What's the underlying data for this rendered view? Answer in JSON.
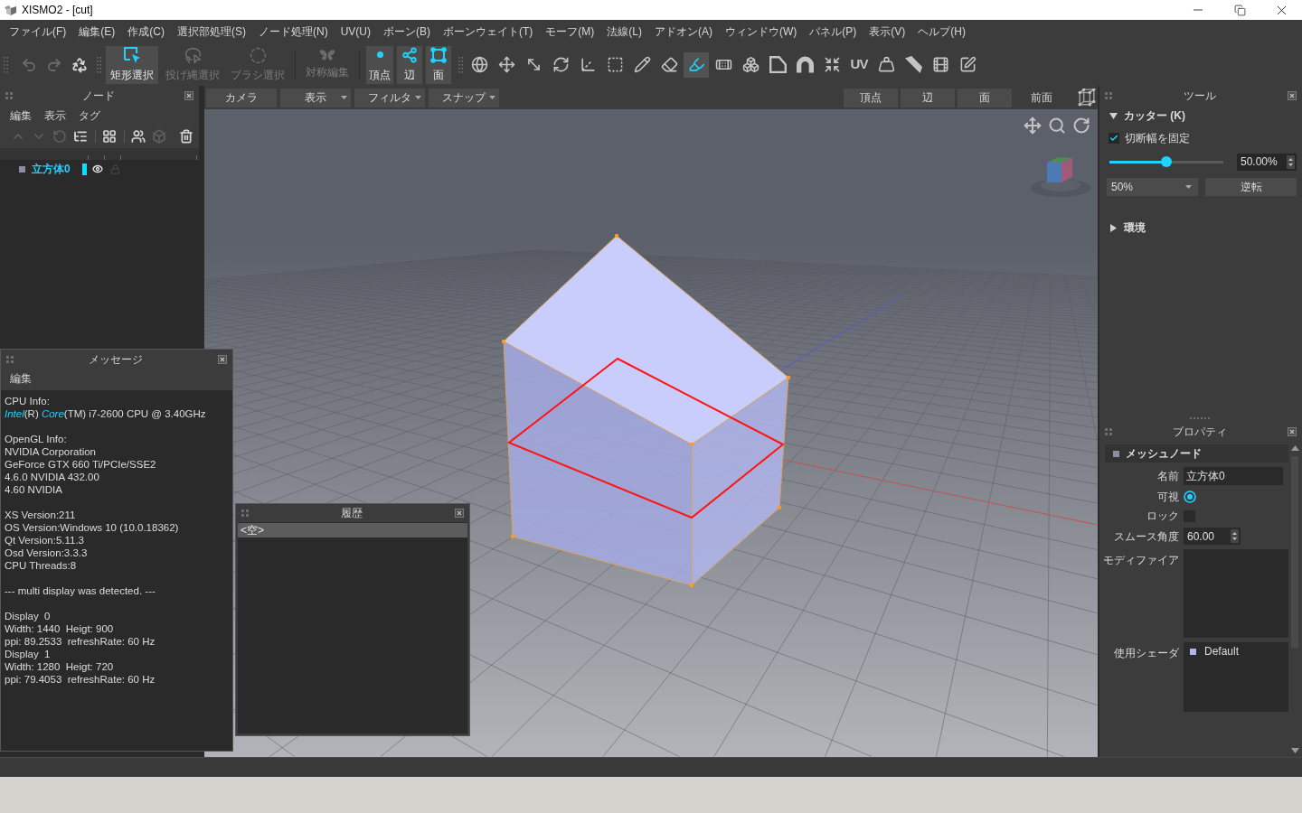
{
  "window": {
    "title": "XISMO2 - [cut]"
  },
  "menu": [
    "ファイル(F)",
    "編集(E)",
    "作成(C)",
    "選択部処理(S)",
    "ノード処理(N)",
    "UV(U)",
    "ボーン(B)",
    "ボーンウェイト(T)",
    "モーフ(M)",
    "法線(L)",
    "アドオン(A)",
    "ウィンドウ(W)",
    "パネル(P)",
    "表示(V)",
    "ヘルプ(H)"
  ],
  "toolbar": {
    "history_tools": [
      {
        "kind": "undo",
        "disabled": true
      },
      {
        "kind": "redo",
        "disabled": true
      },
      {
        "kind": "recycle",
        "disabled": false
      }
    ],
    "select_modes": [
      {
        "kind": "rect",
        "label": "矩形選択",
        "selected": true
      },
      {
        "kind": "lasso",
        "label": "投げ縄選択",
        "selected": false
      },
      {
        "kind": "brush",
        "label": "ブラシ選択",
        "selected": false
      }
    ],
    "symmetry": {
      "label": "対称編集",
      "on": false
    },
    "element_modes": [
      {
        "kind": "vertex",
        "label": "頂点",
        "selected": true
      },
      {
        "kind": "edge",
        "label": "辺",
        "selected": true
      },
      {
        "kind": "face",
        "label": "面",
        "selected": true
      }
    ],
    "tools": [
      {
        "kind": "globe",
        "selected": false
      },
      {
        "kind": "move",
        "selected": false
      },
      {
        "kind": "scale",
        "selected": false
      },
      {
        "kind": "rotate",
        "selected": false
      },
      {
        "kind": "pivot",
        "selected": false
      },
      {
        "kind": "marquee",
        "selected": false
      },
      {
        "kind": "pencil",
        "selected": false
      },
      {
        "kind": "eraser",
        "selected": false
      },
      {
        "kind": "cutter",
        "selected": true
      },
      {
        "kind": "bandage",
        "selected": false
      },
      {
        "kind": "boxes",
        "selected": false
      },
      {
        "kind": "plane",
        "selected": false
      },
      {
        "kind": "arch",
        "selected": false
      },
      {
        "kind": "shrink",
        "selected": false
      },
      {
        "kind": "text",
        "label": "UV",
        "selected": false
      },
      {
        "kind": "weight",
        "selected": false
      },
      {
        "kind": "blade",
        "selected": false
      },
      {
        "kind": "film",
        "selected": false
      },
      {
        "kind": "edit",
        "selected": false
      }
    ]
  },
  "node_panel": {
    "title": "ノード",
    "menu": [
      "編集",
      "表示",
      "タグ"
    ],
    "tools": [
      {
        "kind": "up",
        "disabled": true
      },
      {
        "kind": "down",
        "disabled": true
      },
      {
        "kind": "reset",
        "disabled": true
      },
      {
        "kind": "hierarchy",
        "disabled": false
      },
      {
        "kind": "grid",
        "disabled": false
      },
      {
        "kind": "group",
        "disabled": false
      },
      {
        "kind": "cube",
        "disabled": true
      },
      {
        "kind": "trash",
        "disabled": false
      }
    ],
    "tree": [
      {
        "name": "立方体0",
        "selected": true,
        "color": "#00e5ff",
        "visible": true,
        "locked": false
      }
    ]
  },
  "viewport": {
    "menus": [
      {
        "label": "カメラ",
        "dropdown": false
      },
      {
        "label": "表示",
        "dropdown": true
      },
      {
        "label": "フィルタ",
        "dropdown": true
      },
      {
        "label": "スナップ",
        "dropdown": true
      }
    ],
    "element_buttons": [
      "頂点",
      "辺",
      "面"
    ],
    "view_name": "前面"
  },
  "message_panel": {
    "title": "メッセージ",
    "menu": [
      "編集"
    ],
    "blocks": [
      [
        "CPU Info:",
        "*Intel*(R) *Core*(TM) i7-2600 CPU @ 3.40GHz"
      ],
      [
        "OpenGL Info:",
        "NVIDIA Corporation",
        "GeForce GTX 660 Ti/PCIe/SSE2",
        "4.6.0 NVIDIA 432.00",
        "4.60 NVIDIA"
      ],
      [
        "XS Version:211",
        "OS Version:Windows 10 (10.0.18362)",
        "Qt Version:5.11.3",
        "Osd Version:3.3.3",
        "CPU Threads:8"
      ],
      [
        "--- multi display was detected. ---"
      ],
      [
        "Display  0",
        "Width: 1440  Heigt: 900",
        "ppi: 89.2533  refreshRate: 60 Hz",
        "Display  1",
        "Width: 1280  Heigt: 720",
        "ppi: 79.4053  refreshRate: 60 Hz"
      ]
    ]
  },
  "history_panel": {
    "title": "履歴",
    "items": [
      {
        "label": "<空>",
        "selected": true
      }
    ]
  },
  "tool_panel": {
    "title": "ツール",
    "cutter": {
      "title": "カッター (K)",
      "expanded": true,
      "fixed_width": {
        "label": "切断幅を固定",
        "checked": true
      },
      "width": {
        "level": 0.5,
        "value": "50.00%"
      },
      "preset": "50%",
      "reverse_button": "逆転"
    },
    "environment": {
      "title": "環境",
      "expanded": false
    }
  },
  "properties_panel": {
    "title": "プロパティ",
    "section": "メッシュノード",
    "fields": [
      {
        "kind": "text",
        "label": "名前",
        "value": "立方体0"
      },
      {
        "kind": "radio",
        "label": "可視",
        "checked": true
      },
      {
        "kind": "checkbox",
        "label": "ロック",
        "checked": false
      },
      {
        "kind": "spin",
        "label": "スムース角度",
        "value": "60.00"
      },
      {
        "kind": "list",
        "label": "モディファイア"
      },
      {
        "kind": "list",
        "label": "使用シェーダ",
        "items": [
          "Default"
        ]
      }
    ]
  }
}
